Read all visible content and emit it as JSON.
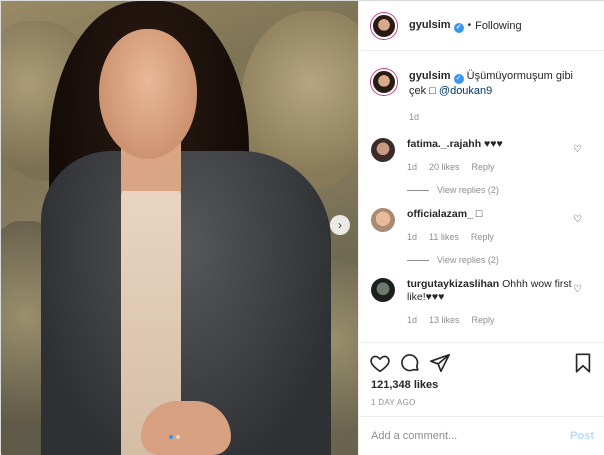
{
  "header": {
    "username": "gyulsim",
    "verified_glyph": "✓",
    "separator": "•",
    "follow_label": "Following"
  },
  "caption": {
    "username": "gyulsim",
    "text": "Üşümüyormuşum gibi çek",
    "tag_icon": "□",
    "mention": "@doukan9",
    "time": "1d"
  },
  "comments": [
    {
      "username": "fatima._.rajahh",
      "text": "♥♥♥",
      "time": "1d",
      "likes": "20 likes",
      "reply": "Reply",
      "view_replies": "View replies (2)"
    },
    {
      "username": "officialazam_",
      "text": "□",
      "time": "1d",
      "likes": "11 likes",
      "reply": "Reply",
      "view_replies": "View replies (2)"
    },
    {
      "username": "turgutaykizaslihan",
      "text": "Ohhh wow first like!♥♥♥",
      "time": "1d",
      "likes": "13 likes",
      "reply": "Reply"
    }
  ],
  "actions": {
    "likes": "121,348 likes",
    "date": "1 DAY AGO",
    "comment_placeholder": "Add a comment...",
    "post_label": "Post"
  },
  "icons": {
    "like": "heart-outline-icon",
    "comment": "comment-bubble-icon",
    "share": "paper-plane-icon",
    "save": "bookmark-icon",
    "next": "chevron-right-icon"
  },
  "carousel": {
    "next_glyph": "›",
    "slides": 2,
    "active_slide": 1
  },
  "colors": {
    "accent": "#3897f0",
    "muted": "#8e8e8e",
    "post_disabled": "#b3dbff"
  }
}
